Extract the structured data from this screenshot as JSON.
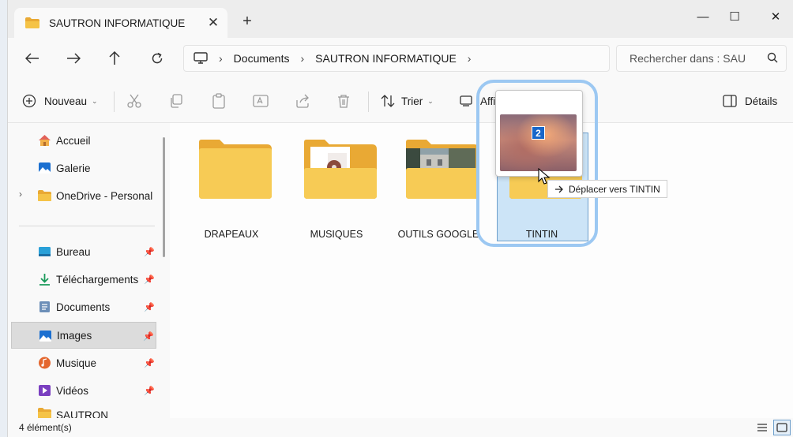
{
  "window": {
    "tab_title": "SAUTRON INFORMATIQUE",
    "tab_close": "✕",
    "new_tab": "+",
    "controls": [
      "—",
      "☐",
      "✕"
    ]
  },
  "nav": {
    "back_icon": "arrow-left-icon",
    "forward_icon": "arrow-right-icon",
    "up_icon": "arrow-up-icon",
    "refresh_icon": "refresh-icon"
  },
  "address": {
    "crumbs": [
      "Documents",
      "SAUTRON INFORMATIQUE"
    ],
    "search_placeholder": "Rechercher dans : SAU"
  },
  "toolbar": {
    "new_label": "Nouveau",
    "sort_label": "Trier",
    "view_label": "Affi",
    "details_label": "Détails"
  },
  "sidebar": {
    "items": [
      {
        "label": "Accueil",
        "icon": "home-icon",
        "pinned": false
      },
      {
        "label": "Galerie",
        "icon": "gallery-icon",
        "pinned": false
      },
      {
        "label": "OneDrive - Personal",
        "icon": "onedrive-folder-icon",
        "pinned": false
      },
      {
        "label": "Bureau",
        "icon": "desktop-icon",
        "pinned": true
      },
      {
        "label": "Téléchargements",
        "icon": "download-icon",
        "pinned": true
      },
      {
        "label": "Documents",
        "icon": "documents-icon",
        "pinned": true
      },
      {
        "label": "Images",
        "icon": "pictures-icon",
        "pinned": true
      },
      {
        "label": "Musique",
        "icon": "music-icon",
        "pinned": true
      },
      {
        "label": "Vidéos",
        "icon": "videos-icon",
        "pinned": true
      },
      {
        "label": "SAUTRON INFORM...",
        "icon": "folder-icon",
        "pinned": false
      }
    ],
    "selected": "Images"
  },
  "folders": [
    {
      "name": "DRAPEAUX"
    },
    {
      "name": "MUSIQUES"
    },
    {
      "name": "OUTILS GOOGLE"
    },
    {
      "name": "TINTIN"
    }
  ],
  "drag": {
    "count": "2",
    "tooltip": "Déplacer vers TINTIN"
  },
  "status": {
    "count_text": "4 élément(s)"
  },
  "colors": {
    "folder": "#f5c347",
    "folder_back": "#e9a934",
    "selection": "#cce4f7",
    "accent": "#1766c9"
  }
}
